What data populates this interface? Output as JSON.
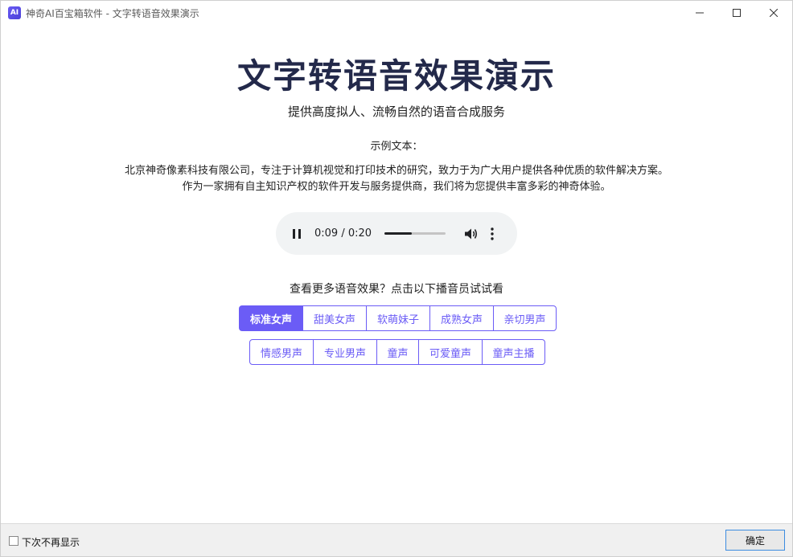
{
  "window": {
    "title": "神奇AI百宝箱软件 - 文字转语音效果演示",
    "app_icon_text": "AI",
    "controls": {
      "minimize": "minimize-icon",
      "maximize": "maximize-icon",
      "close": "close-icon"
    }
  },
  "main": {
    "title": "文字转语音效果演示",
    "subtitle": "提供高度拟人、流畅自然的语音合成服务",
    "sample_label": "示例文本：",
    "sample_lines": [
      "北京神奇像素科技有限公司，专注于计算机视觉和打印技术的研究，致力于为广大用户提供各种优质的软件解决方案。",
      "作为一家拥有自主知识产权的软件开发与服务提供商，我们将为您提供丰富多彩的神奇体验。"
    ],
    "player": {
      "time": "0:09 / 0:20",
      "progress_fraction": 0.45,
      "state": "playing"
    },
    "more_prompt": "查看更多语音效果？点击以下播音员试试看",
    "voices_row1": [
      {
        "label": "标准女声",
        "active": true
      },
      {
        "label": "甜美女声",
        "active": false
      },
      {
        "label": "软萌妹子",
        "active": false
      },
      {
        "label": "成熟女声",
        "active": false
      },
      {
        "label": "亲切男声",
        "active": false
      }
    ],
    "voices_row2": [
      {
        "label": "情感男声",
        "active": false
      },
      {
        "label": "专业男声",
        "active": false
      },
      {
        "label": "童声",
        "active": false
      },
      {
        "label": "可爱童声",
        "active": false
      },
      {
        "label": "童声主播",
        "active": false
      }
    ]
  },
  "footer": {
    "dont_show_again": "下次不再显示",
    "checked": false,
    "ok_label": "确定"
  },
  "colors": {
    "accent": "#6b5cf6",
    "title": "#23294a",
    "player_bg": "#f1f3f4"
  }
}
